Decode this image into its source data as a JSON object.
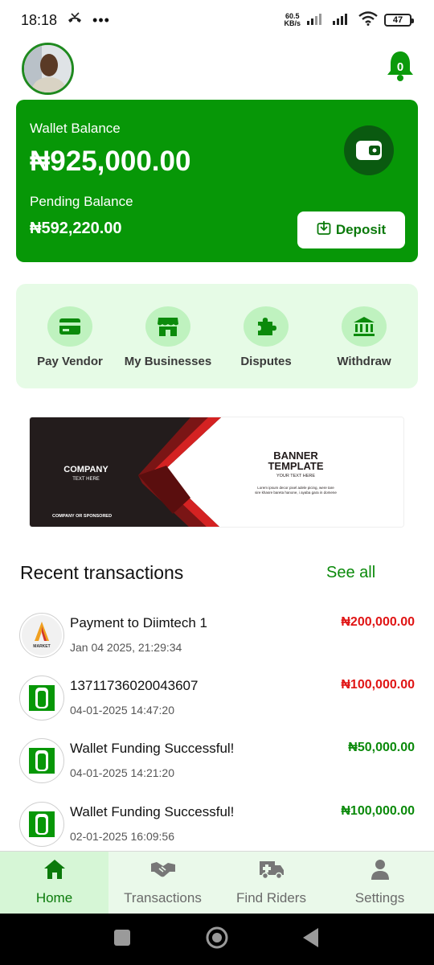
{
  "status": {
    "time": "18:18",
    "speed_value": "60.5",
    "speed_unit": "KB/s",
    "battery": "47"
  },
  "header": {
    "notification_count": "0"
  },
  "wallet": {
    "balance_label": "Wallet Balance",
    "balance": "₦925,000.00",
    "pending_label": "Pending Balance",
    "pending": "₦592,220.00",
    "deposit_label": "Deposit"
  },
  "actions": [
    {
      "label": "Pay Vendor",
      "icon": "card-icon"
    },
    {
      "label": "My Businesses",
      "icon": "store-icon"
    },
    {
      "label": "Disputes",
      "icon": "puzzle-icon"
    },
    {
      "label": "Withdraw",
      "icon": "bank-icon"
    }
  ],
  "banner": {
    "company": "COMPANY",
    "company_sub": "TEXT HERE",
    "sponsor": "COMPANY OR SPONSORED",
    "title_line1": "BANNER",
    "title_line2": "TEMPLATE",
    "subtitle": "YOUR TEXT HERE",
    "body_line1": "Lorem ipsum decor pixel adele picing, were tare",
    "body_line2": "sire khasre bareta hanone, i ayaba gara in domene"
  },
  "transactions": {
    "title": "Recent transactions",
    "see_all": "See all",
    "items": [
      {
        "title": "Payment to Diimtech 1",
        "date": "Jan 04 2025, 21:29:34",
        "amount": "₦200,000.00",
        "type": "debit",
        "logo_text": "MARKET"
      },
      {
        "title": "13711736020043607",
        "date": "04-01-2025 14:47:20",
        "amount": "₦100,000.00",
        "type": "debit"
      },
      {
        "title": "Wallet Funding Successful!",
        "date": "04-01-2025 14:21:20",
        "amount": "₦50,000.00",
        "type": "credit"
      },
      {
        "title": "Wallet Funding Successful!",
        "date": "02-01-2025 16:09:56",
        "amount": "₦100,000.00",
        "type": "credit"
      }
    ]
  },
  "nav": [
    {
      "label": "Home",
      "icon": "home-icon",
      "active": true
    },
    {
      "label": "Transactions",
      "icon": "handshake-icon",
      "active": false
    },
    {
      "label": "Find Riders",
      "icon": "ambulance-icon",
      "active": false
    },
    {
      "label": "Settings",
      "icon": "person-icon",
      "active": false
    }
  ],
  "colors": {
    "brand_green": "#079707",
    "debit_red": "#e01515",
    "credit_green": "#0b8a0b"
  }
}
